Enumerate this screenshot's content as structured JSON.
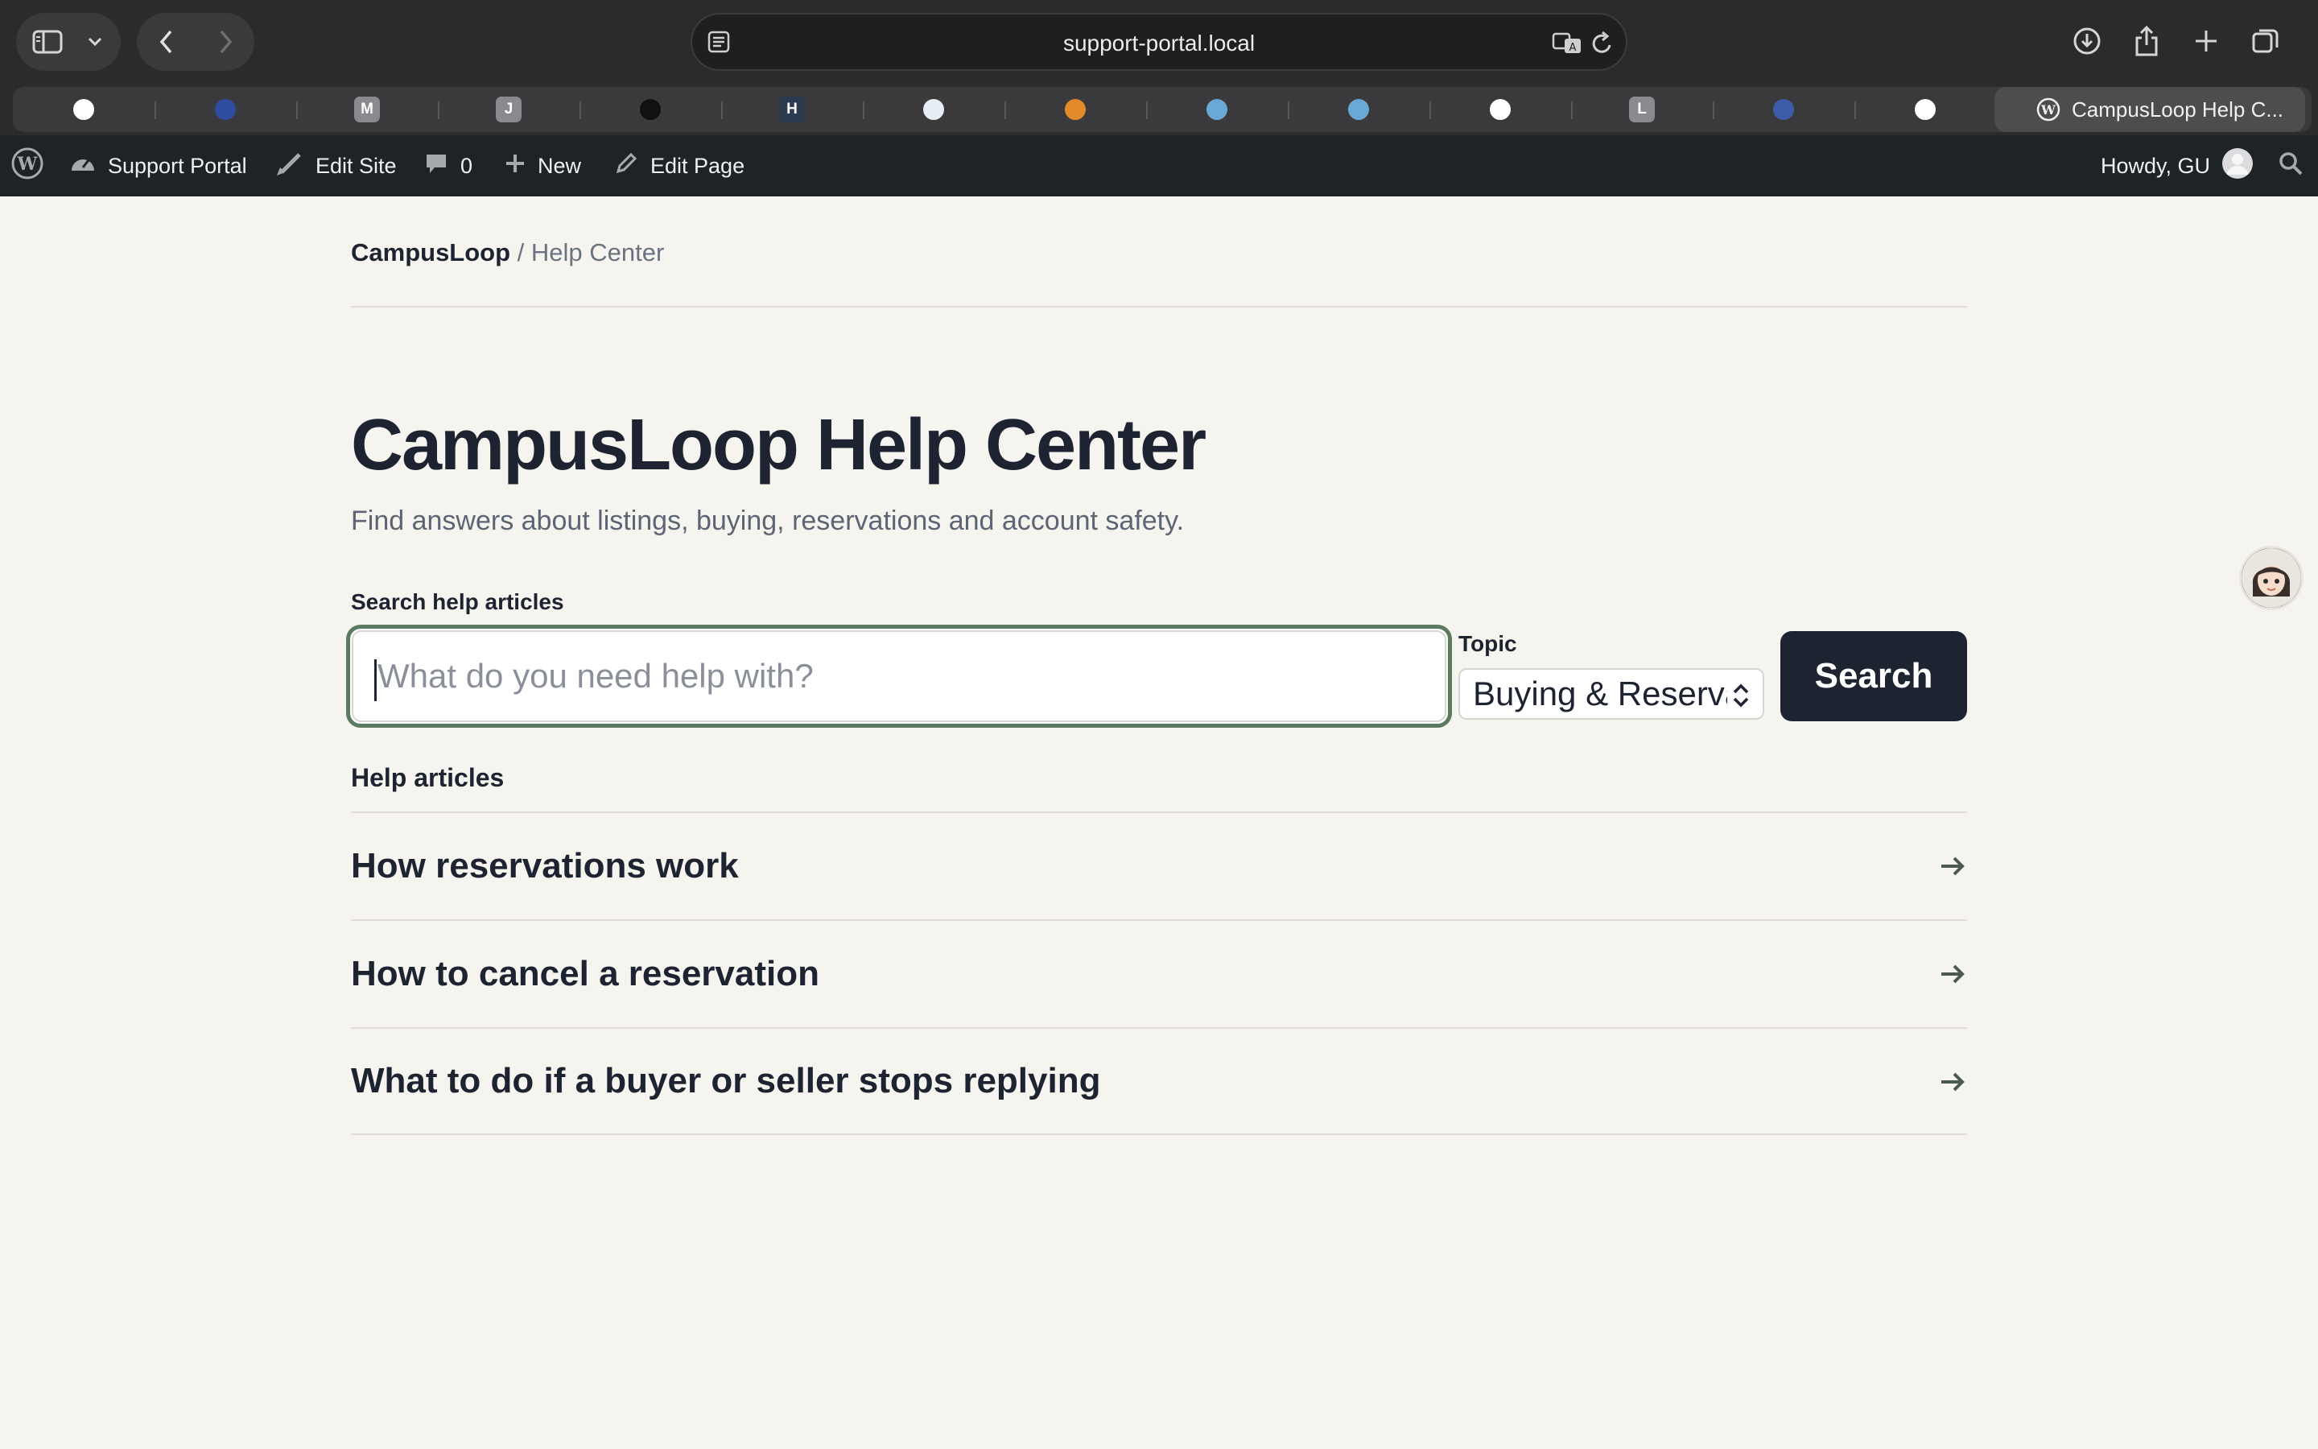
{
  "browser": {
    "url": "support-portal.local",
    "active_tab_title": "CampusLoop Help C...",
    "favorites": [
      {
        "name": "chatgpt-icon",
        "letter": "",
        "color": "#ffffff"
      },
      {
        "name": "globe-app-icon",
        "letter": "",
        "color": "#2d4da3"
      },
      {
        "name": "m-tab-icon",
        "letter": "M",
        "color": "#8a8a8e"
      },
      {
        "name": "j-tab-icon",
        "letter": "J",
        "color": "#8a8a8e"
      },
      {
        "name": "triangle-app-icon",
        "letter": "",
        "color": "#111111"
      },
      {
        "name": "h-tab-icon",
        "letter": "H",
        "color": "#2c3a4f"
      },
      {
        "name": "shirt-app-icon",
        "letter": "",
        "color": "#e8eef6"
      },
      {
        "name": "orange-app-icon",
        "letter": "",
        "color": "#e38a2a"
      },
      {
        "name": "stripe-app-icon",
        "letter": "",
        "color": "#6aa8d8"
      },
      {
        "name": "stripe-app-icon-2",
        "letter": "",
        "color": "#6aa8d8"
      },
      {
        "name": "github-icon",
        "letter": "",
        "color": "#ffffff"
      },
      {
        "name": "l-tab-icon",
        "letter": "L",
        "color": "#8a8a8e"
      },
      {
        "name": "crest-app-icon",
        "letter": "",
        "color": "#3c5ea8"
      },
      {
        "name": "github-icon-2",
        "letter": "",
        "color": "#ffffff"
      }
    ]
  },
  "admin_bar": {
    "site_name": "Support Portal",
    "edit_site": "Edit Site",
    "comments_count": "0",
    "new_label": "New",
    "edit_page": "Edit Page",
    "howdy": "Howdy, GU"
  },
  "page": {
    "breadcrumb_home": "CampusLoop",
    "breadcrumb_separator": " / ",
    "breadcrumb_current": "Help Center",
    "title": "CampusLoop Help Center",
    "subtitle": "Find answers about listings, buying, reservations and account safety.",
    "search_label": "Search help articles",
    "search_placeholder": "What do you need help with?",
    "topic_label": "Topic",
    "topic_value": "Buying & Reservations",
    "search_button": "Search",
    "articles_heading": "Help articles",
    "articles": [
      {
        "title": "How reservations work"
      },
      {
        "title": "How to cancel a reservation"
      },
      {
        "title": "What to do if a buyer or seller stops replying"
      }
    ]
  },
  "colors": {
    "page_bg": "#f5f4ef",
    "ink": "#1d2330",
    "focus_ring": "#5b7a60",
    "admin_bar": "#1d2327"
  }
}
